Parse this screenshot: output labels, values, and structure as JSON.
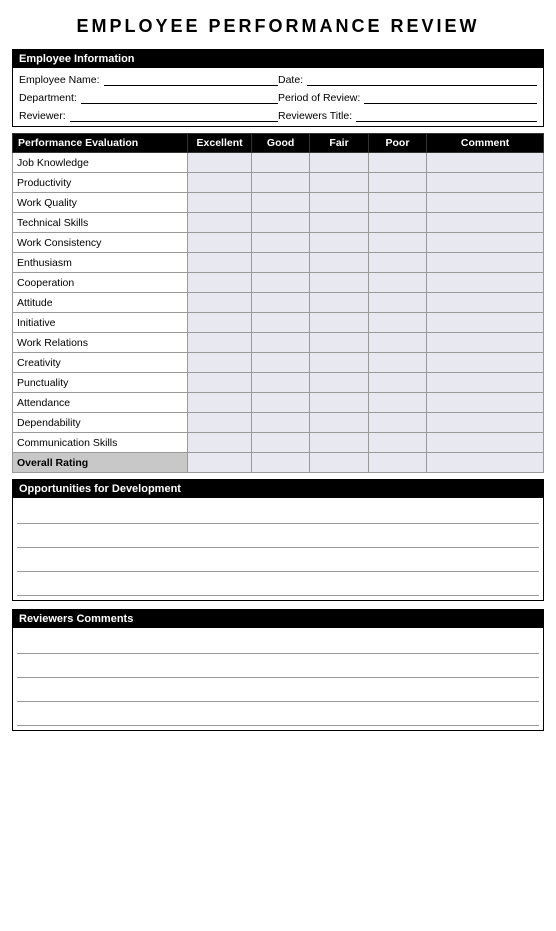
{
  "title": "EMPLOYEE  PERFORMANCE  REVIEW",
  "infoSection": {
    "header": "Employee Information",
    "fields": [
      {
        "label": "Employee Name:",
        "col": 1
      },
      {
        "label": "Date:",
        "col": 2
      },
      {
        "label": "Department:",
        "col": 1
      },
      {
        "label": "Period of Review:",
        "col": 2
      },
      {
        "label": "Reviewer:",
        "col": 1
      },
      {
        "label": "Reviewers Title:",
        "col": 2
      }
    ]
  },
  "evalTable": {
    "headers": [
      "Performance Evaluation",
      "Excellent",
      "Good",
      "Fair",
      "Poor",
      "Comment"
    ],
    "rows": [
      "Job Knowledge",
      "Productivity",
      "Work Quality",
      "Technical Skills",
      "Work Consistency",
      "Enthusiasm",
      "Cooperation",
      "Attitude",
      "Initiative",
      "Work Relations",
      "Creativity",
      "Punctuality",
      "Attendance",
      "Dependability",
      "Communication Skills"
    ],
    "overallLabel": "Overall Rating"
  },
  "developmentSection": {
    "header": "Opportunities for Development",
    "lineCount": 4
  },
  "commentsSection": {
    "header": "Reviewers Comments",
    "lineCount": 4
  }
}
